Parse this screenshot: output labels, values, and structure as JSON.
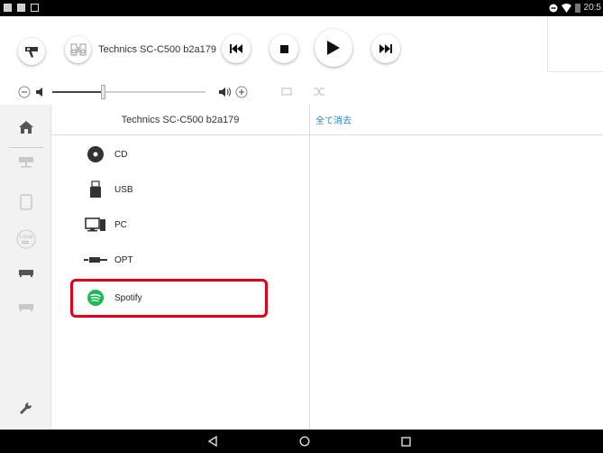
{
  "status_bar": {
    "time": "20:5"
  },
  "toolbar": {
    "settings_icon": "remote-icon",
    "device_name": "Technics SC-C500 b2a179",
    "buttons": [
      "previous",
      "stop",
      "play",
      "next"
    ]
  },
  "volume": {
    "level": 0.33
  },
  "sidebar": {
    "items": [
      {
        "name": "home",
        "icon": "home-icon"
      },
      {
        "name": "network",
        "icon": "network-device-icon"
      },
      {
        "name": "tablet",
        "icon": "tablet-icon"
      },
      {
        "name": "local",
        "icon": "local-music-icon",
        "label": "Local"
      },
      {
        "name": "device-a",
        "icon": "device-icon"
      },
      {
        "name": "device-b",
        "icon": "device-icon"
      }
    ]
  },
  "panel": {
    "title": "Technics SC-C500 b2a179",
    "sources": [
      {
        "label": "CD",
        "icon": "disc-icon"
      },
      {
        "label": "USB",
        "icon": "usb-icon"
      },
      {
        "label": "PC",
        "icon": "pc-icon"
      },
      {
        "label": "OPT",
        "icon": "optical-icon"
      },
      {
        "label": "Spotify",
        "icon": "spotify-icon"
      }
    ]
  },
  "queue": {
    "clear_all_label": "全て消去"
  },
  "colors": {
    "accent": "#2b7fd8",
    "highlight": "#e0001a",
    "spotify": "#1db954"
  }
}
